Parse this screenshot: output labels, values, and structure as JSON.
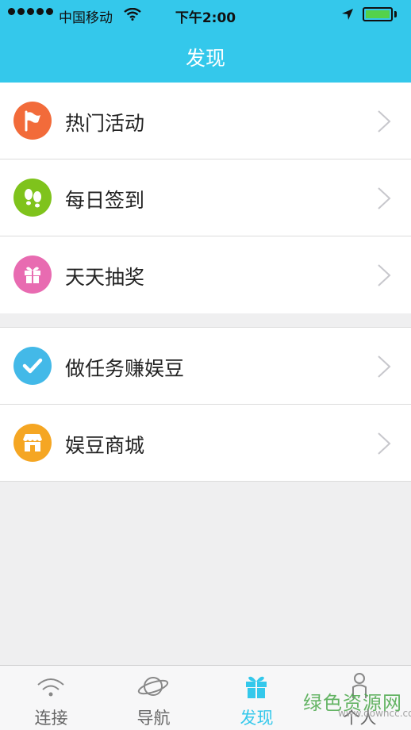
{
  "status_bar": {
    "carrier": "中国移动",
    "time": "下午2:00",
    "battery_level": 1.0
  },
  "header": {
    "title": "发现"
  },
  "groups": [
    {
      "items": [
        {
          "label": "热门活动",
          "icon": "flag-icon",
          "color": "#f26b3a"
        },
        {
          "label": "每日签到",
          "icon": "footprints-icon",
          "color": "#7fc31c"
        },
        {
          "label": "天天抽奖",
          "icon": "gift-icon",
          "color": "#e86bb1"
        }
      ]
    },
    {
      "items": [
        {
          "label": "做任务赚娱豆",
          "icon": "checkmark-icon",
          "color": "#43b9e8"
        },
        {
          "label": "娱豆商城",
          "icon": "shop-icon",
          "color": "#f5a623"
        }
      ]
    }
  ],
  "tabbar": {
    "tabs": [
      {
        "label": "连接",
        "icon": "wifi-icon",
        "active": false
      },
      {
        "label": "导航",
        "icon": "planet-icon",
        "active": false
      },
      {
        "label": "发现",
        "icon": "gift-icon",
        "active": true
      },
      {
        "label": "个人",
        "icon": "person-icon",
        "active": false
      }
    ]
  },
  "watermark": {
    "text": "绿色资源网",
    "url_text": "www.downcc.com"
  },
  "colors": {
    "accent": "#34c8eb",
    "background": "#efeff0"
  }
}
